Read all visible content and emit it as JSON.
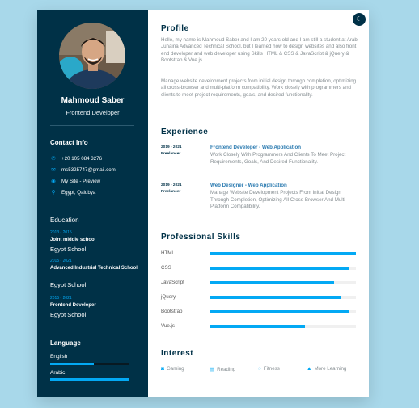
{
  "profile_card": {
    "name": "Mahmoud Saber",
    "role": "Frontend Developer"
  },
  "contact": {
    "title": "Contact Info",
    "items": [
      {
        "icon": "phone-icon",
        "glyph": "✆",
        "text": "+20 105 084 3276"
      },
      {
        "icon": "email-icon",
        "glyph": "✉",
        "text": "ms5325747@gmail.com"
      },
      {
        "icon": "globe-icon",
        "glyph": "◉",
        "text": "My Site - Preview"
      },
      {
        "icon": "location-icon",
        "glyph": "⚲",
        "text": "Egypt, Qalubya"
      }
    ]
  },
  "education": {
    "title": "Education",
    "items": [
      {
        "year": "2013 - 2015",
        "degree": "Joint middle school",
        "place": "Egypt School"
      },
      {
        "year": "2015 - 2021",
        "degree": "Advanced Industrial Technical School",
        "place": "Egypt School"
      },
      {
        "year": "2015 - 2021",
        "degree": "Frontend Developer",
        "place": "Egypt School"
      }
    ]
  },
  "language": {
    "title": "Language",
    "items": [
      {
        "name": "English",
        "level": 0.55
      },
      {
        "name": "Arabic",
        "level": 1.0
      }
    ]
  },
  "profile": {
    "title": "Profile",
    "para1": "Hello, my name is Mahmoud Saber and I am 20 years old and I am still a student at Arab Juhaina Advanced Technical School, but I learned how to design websites and also front end developer and web developer using Skills HTML & CSS & JavaScript & jQuery & Bootstrap & Vue.js.",
    "para2": "Manage website development projects from initial design through completion, optimizing all cross-browser and multi-platform compatibility. Work closely with programmers and clients to meet project requirements, goals, and desired functionality."
  },
  "experience": {
    "title": "Experience",
    "items": [
      {
        "year": "2019 - 2021",
        "company": "Freelancer",
        "title": "Frontend Developer - Web Application",
        "text": "Work Closely With Programmers And Clients To Meet Project Requirements, Goals, And Desired Functionality."
      },
      {
        "year": "2019 - 2021",
        "company": "Freelancer",
        "title": "Web Designer - Web Application",
        "text": "Manage Website Development Projects From Initial Design Through Completion, Optimizing All Cross-Browser And Multi-Platform Compatibility."
      }
    ]
  },
  "skills": {
    "title": "Professional Skills",
    "items": [
      {
        "name": "HTML",
        "level": 1.0
      },
      {
        "name": "CSS",
        "level": 0.95
      },
      {
        "name": "JavaScript",
        "level": 0.85
      },
      {
        "name": "jQuery",
        "level": 0.9
      },
      {
        "name": "Bootstrap",
        "level": 0.95
      },
      {
        "name": "Vue.js",
        "level": 0.65
      }
    ]
  },
  "interest": {
    "title": "Interest",
    "items": [
      {
        "icon": "gamepad-icon",
        "glyph": "◙",
        "label": "Gaming"
      },
      {
        "icon": "book-icon",
        "glyph": "▤",
        "label": "Reading"
      },
      {
        "icon": "fitness-icon",
        "glyph": "◌",
        "label": "Fitness"
      },
      {
        "icon": "graduation-cap-icon",
        "glyph": "▲",
        "label": "More Learning"
      }
    ]
  },
  "theme": {
    "accent": "#03a9f4",
    "sidebar": "#003147",
    "background": "#a8d8ea"
  }
}
